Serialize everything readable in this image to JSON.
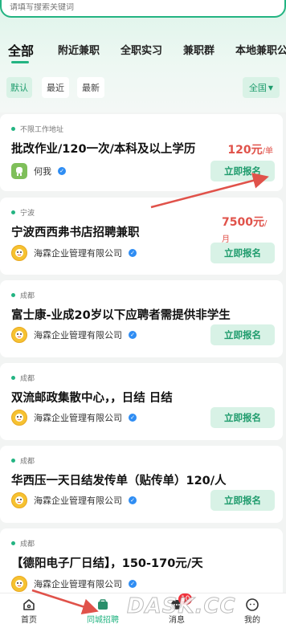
{
  "search": {
    "placeholder": "请填写搜索关键词"
  },
  "tabs": [
    {
      "label": "全部",
      "active": true
    },
    {
      "label": "附近兼职"
    },
    {
      "label": "全职实习"
    },
    {
      "label": "兼职群"
    },
    {
      "label": "本地兼职公"
    }
  ],
  "filters": {
    "default": "默认",
    "recent": "最近",
    "newest": "最新",
    "location": "全国"
  },
  "apply_label": "立即报名",
  "jobs": [
    {
      "location": "不限工作地址",
      "title": "批改作业/120一次/本科及以上学历",
      "salary": "120元",
      "salary_unit": "/单",
      "company": "何我"
    },
    {
      "location": "宁波",
      "title": "宁波西西弗书店招聘兼职",
      "salary": "7500元",
      "salary_unit": "/月",
      "company": "海霖企业管理有限公司"
    },
    {
      "location": "成都",
      "title": "富士康-业成20岁以下应聘者需提供非学生",
      "company": "海霖企业管理有限公司"
    },
    {
      "location": "成都",
      "title": "双流邮政集散中心，，日结 日结",
      "company": "海霖企业管理有限公司"
    },
    {
      "location": "成都",
      "title": "华西压一天日结发传单（贴传单）120/人",
      "company": "海霖企业管理有限公司"
    },
    {
      "location": "成都",
      "title": "【德阳电子厂日结】，150-170元/天",
      "company": "海霖企业管理有限公司"
    }
  ],
  "tabbar": {
    "home": "首页",
    "recruit": "同城招聘",
    "messages": "消息",
    "messages_badge": "10",
    "mine": "我的"
  },
  "watermark": "DASK.CC",
  "colors": {
    "accent": "#23b482",
    "salary": "#e0524a",
    "badge": "#f0323c",
    "arrow": "#e0524a"
  }
}
